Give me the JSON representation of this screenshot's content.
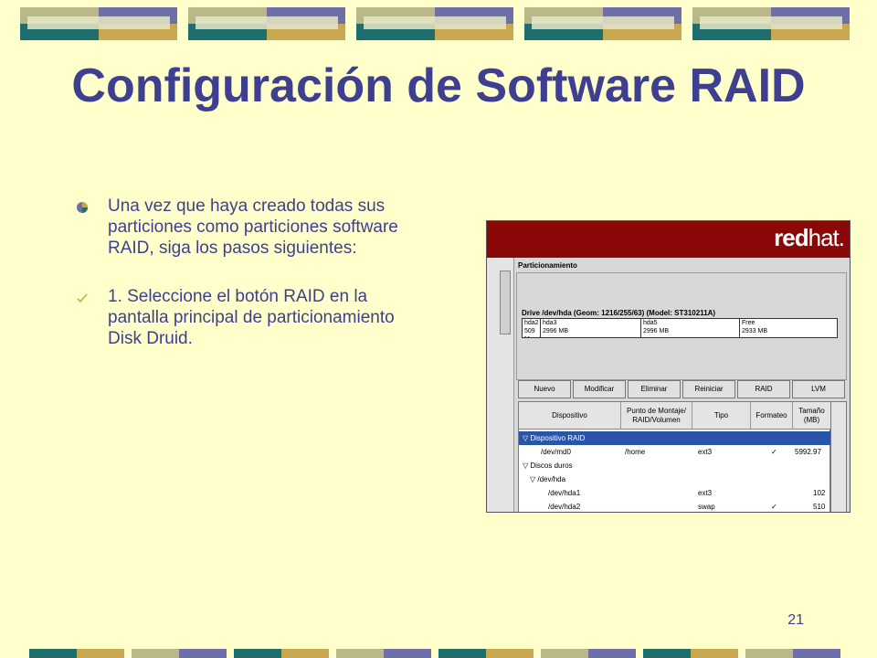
{
  "slide": {
    "title": "Configuración de Software RAID",
    "bullets": [
      "Una vez que haya creado todas sus particiones como particiones software RAID, siga los pasos siguientes:",
      "1. Seleccione el botón RAID en la pantalla principal de particionamiento Disk Druid."
    ],
    "page_number": "21"
  },
  "colors": {
    "background": "#FFFFCC",
    "text": "#3F3F8F",
    "deco_teal": "#1E6E6E",
    "deco_gold": "#C8A850",
    "deco_purple": "#6E6EA8",
    "deco_sage": "#B8B888",
    "banner": "#8A0808",
    "selection": "#2A54A5"
  },
  "screenshot": {
    "logo_bold": "red",
    "logo_light": "hat.",
    "group_label": "Particionamiento",
    "drive_label": "Drive /dev/hda (Geom: 1216/255/63) (Model: ST310211A)",
    "segments": [
      {
        "name": "hda2",
        "size": "509 M"
      },
      {
        "name": "hda3",
        "size": "2996 MB"
      },
      {
        "name": "hda5",
        "size": "2996 MB"
      },
      {
        "name": "Free",
        "size": "2933 MB"
      }
    ],
    "buttons": [
      "Nuevo",
      "Modificar",
      "Eliminar",
      "Reiniciar",
      "RAID",
      "LVM"
    ],
    "columns": [
      "Dispositivo",
      "Punto de Montaje/ RAID/Volumen",
      "Tipo",
      "Formateo",
      "Tamaño (MB)"
    ],
    "rows": [
      {
        "device": "▽ Dispositivo RAID",
        "mount": "",
        "type": "",
        "format": "",
        "size": ""
      },
      {
        "device": "/dev/md0",
        "mount": "/home",
        "type": "ext3",
        "format": "✓",
        "size": "5992.97"
      },
      {
        "device": "▽ Discos duros",
        "mount": "",
        "type": "",
        "format": "",
        "size": ""
      },
      {
        "device": "▽ /dev/hda",
        "mount": "",
        "type": "",
        "format": "",
        "size": ""
      },
      {
        "device": "/dev/hda1",
        "mount": "",
        "type": "ext3",
        "format": "",
        "size": "102"
      },
      {
        "device": "/dev/hda2",
        "mount": "",
        "type": "swap",
        "format": "✓",
        "size": "510"
      }
    ]
  }
}
